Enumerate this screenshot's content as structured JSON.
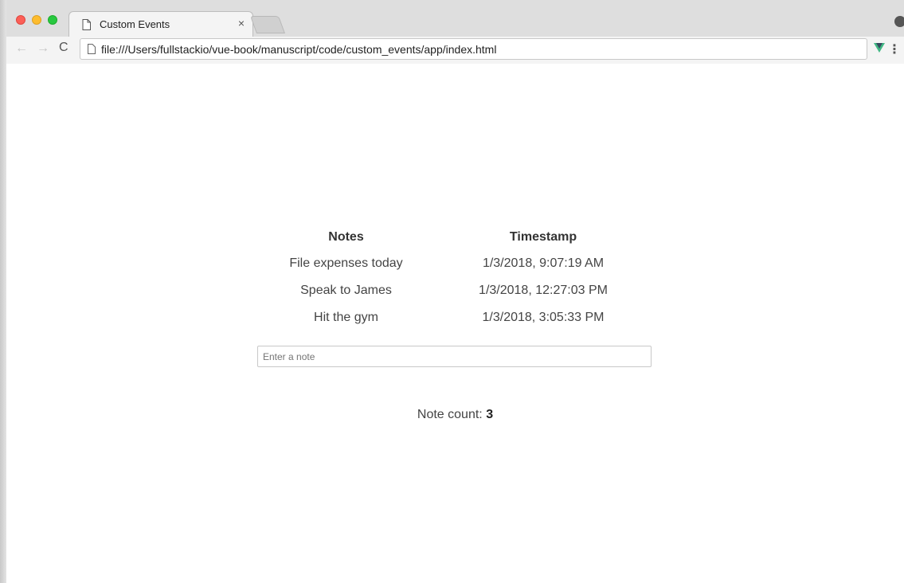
{
  "browser": {
    "tab_title": "Custom Events",
    "tab_close": "×",
    "url": "file:///Users/fullstackio/vue-book/manuscript/code/custom_events/app/index.html",
    "nav_back": "←",
    "nav_forward": "→",
    "reload": "C",
    "menu": "⋮",
    "traffic_colors": {
      "close": "#fc5f57",
      "minimize": "#fdbc2e",
      "zoom": "#28c840"
    },
    "extension_icon": "vue-devtools-icon"
  },
  "notes_table": {
    "headers": {
      "notes": "Notes",
      "timestamp": "Timestamp"
    },
    "rows": [
      {
        "note": "File expenses today",
        "timestamp": "1/3/2018, 9:07:19 AM"
      },
      {
        "note": "Speak to James",
        "timestamp": "1/3/2018, 12:27:03 PM"
      },
      {
        "note": "Hit the gym",
        "timestamp": "1/3/2018, 3:05:33 PM"
      }
    ]
  },
  "note_input": {
    "placeholder": "Enter a note",
    "value": ""
  },
  "note_count": {
    "label": "Note count: ",
    "value": "3"
  }
}
